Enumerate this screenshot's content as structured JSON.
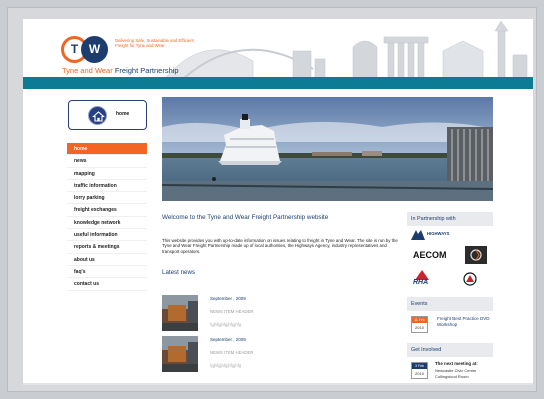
{
  "header": {
    "logo_t": "T",
    "logo_w": "W",
    "tagline": "Delivering Safe, Sustainable and Efficient Freight for Tyne and Wear",
    "brand_part1": "Tyne and Wear ",
    "brand_part2": "Freight Partnership"
  },
  "home_button": {
    "label": "home"
  },
  "nav": {
    "items": [
      "home",
      "news",
      "mapping",
      "traffic information",
      "lorry parking",
      "freight exchanges",
      "knowledge network",
      "useful information",
      "reports & meetings",
      "about us",
      "faq's",
      "contact us"
    ],
    "active_index": 0
  },
  "main": {
    "welcome": "Welcome to the Tyne and Wear Freight Partnership website",
    "intro": "This website provides you with up-to-date information on issues relating to freight in Tyne and Wear. The site is run by the Tyne and Wear Freight Partnership made up of local authorities, the Highways Agency, industry representatives and transport operators.",
    "latest_news_title": "Latest news",
    "news": [
      {
        "date": "September , 2009",
        "header": "NEWS ITEM HEADER",
        "body": "fgjhfgjhfgjhfgjhfg"
      },
      {
        "date": "September , 2009",
        "header": "NEWS ITEM HEADER",
        "body": "fgjhfgjhfgjhfgjhfg"
      }
    ]
  },
  "sidebar": {
    "partnership_title": "In Partnership with",
    "partners": [
      "HIGHWAYS",
      "AECOM",
      "RHA"
    ],
    "events_title": "Events",
    "event": {
      "date_top": "11 Feb",
      "date_year": "2010",
      "text": "Freight Best Practice DVD Workshop"
    },
    "involved_title": "Get Involved",
    "meeting": {
      "date_top": "3 Feb",
      "date_year": "2010",
      "title": "The next meeting at:",
      "place1": "Newcastle Civic Centre",
      "place2": "Collingwood Room"
    }
  },
  "colors": {
    "accent_orange": "#f26522",
    "navy": "#1c3d6e",
    "teal": "#0d7b93"
  }
}
